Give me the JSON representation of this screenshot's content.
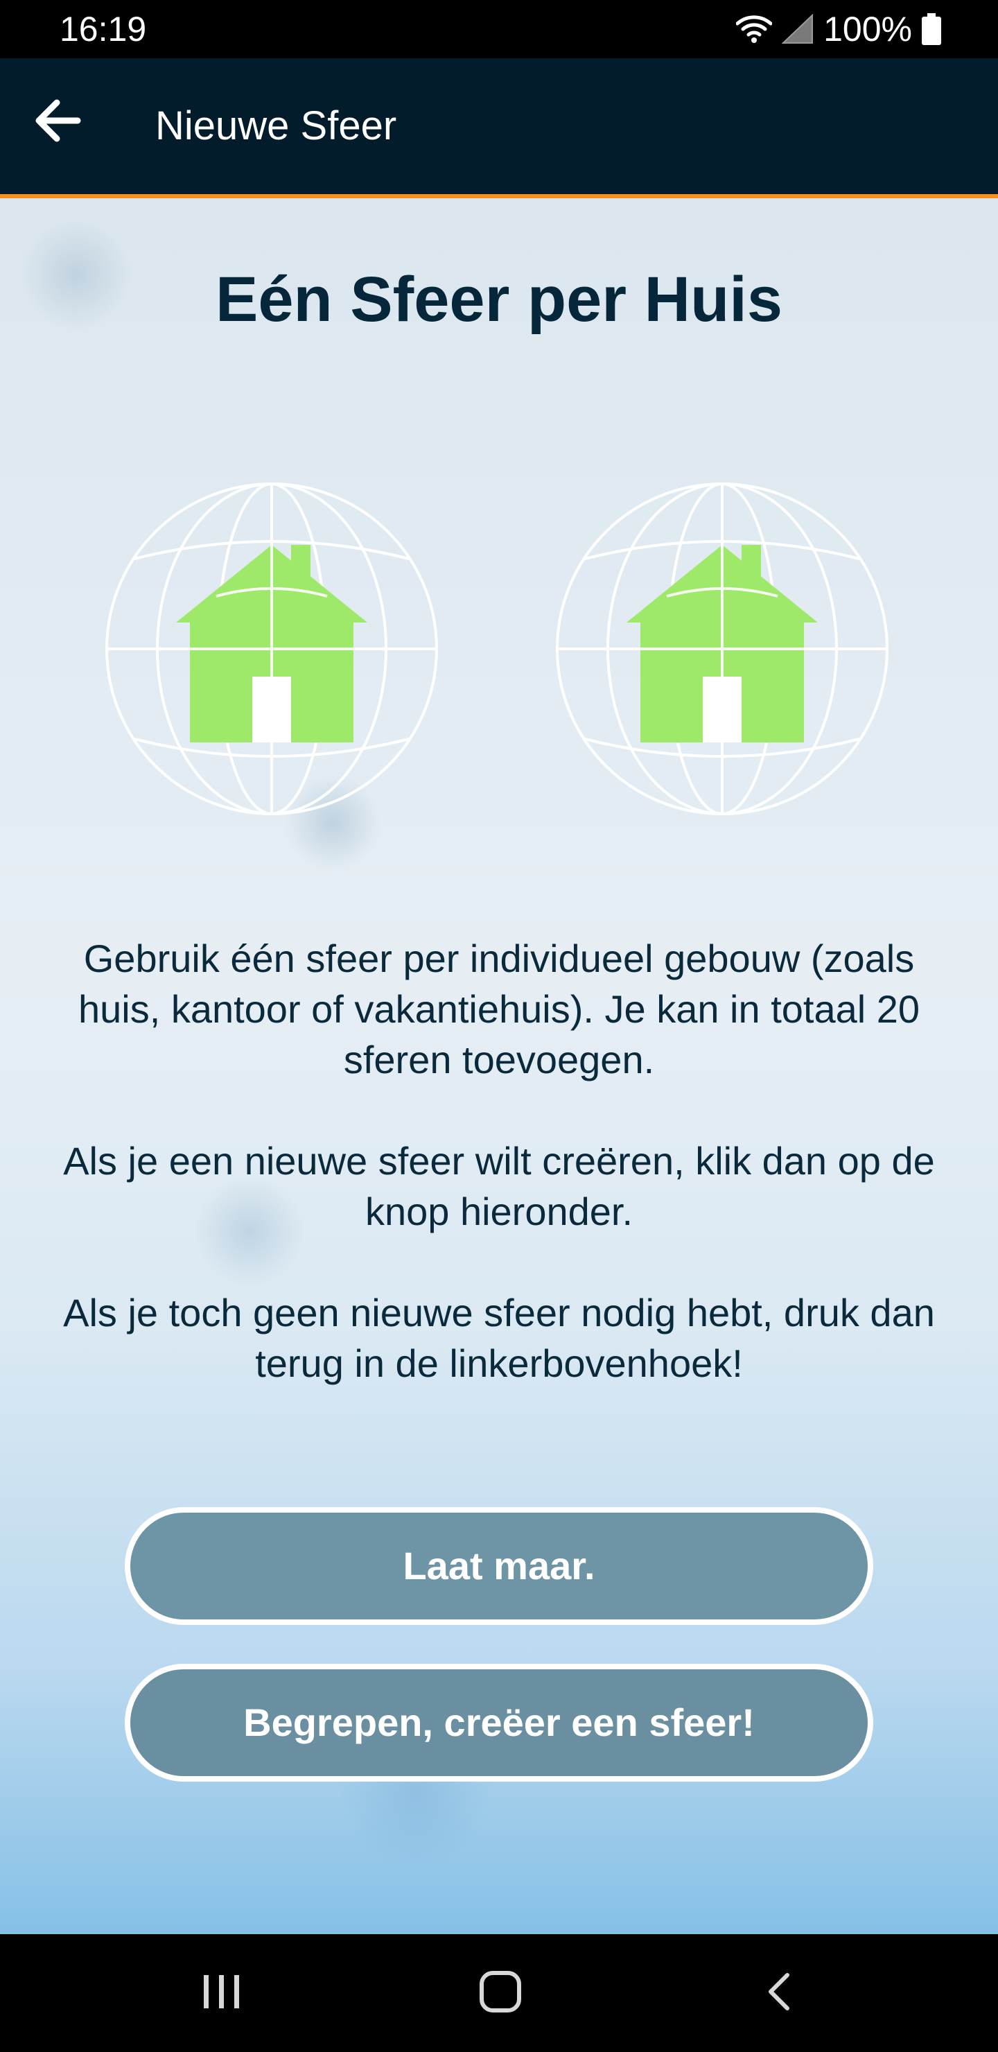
{
  "status_bar": {
    "time": "16:19",
    "battery": "100%",
    "icons": [
      "wifi-icon",
      "signal-icon",
      "battery-icon"
    ]
  },
  "app_bar": {
    "title": "Nieuwe Sfeer",
    "back_icon": "arrow-left-icon"
  },
  "main": {
    "title": "Eén Sfeer per Huis",
    "illustrations": [
      "globe-house-icon",
      "globe-house-icon"
    ],
    "paragraphs": [
      "Gebruik één sfeer per individueel gebouw (zoals huis, kantoor of vakantiehuis). Je kan in totaal 20 sferen toevoegen.",
      "Als je een nieuwe sfeer wilt creëren, klik dan op de knop hieronder.",
      "Als je toch geen nieuwe sfeer nodig hebt, druk dan terug in de linkerbovenhoek!"
    ],
    "buttons": {
      "cancel_label": "Laat maar.",
      "confirm_label": "Begrepen, creëer een sfeer!"
    }
  },
  "nav_bar": {
    "items": [
      "recent-apps-icon",
      "home-icon",
      "back-icon"
    ]
  },
  "colors": {
    "app_bar": "#031c2b",
    "accent": "#f5901e",
    "title_text": "#06263a",
    "house_green": "#9ee86a",
    "button_fill": "#6e95a5"
  }
}
